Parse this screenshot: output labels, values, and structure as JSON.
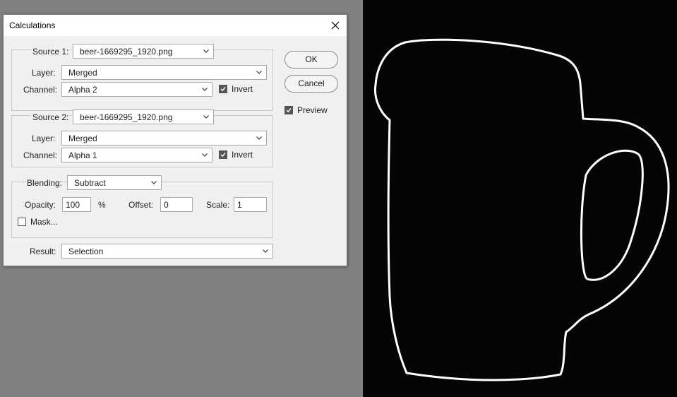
{
  "dialog": {
    "title": "Calculations",
    "source1": {
      "label": "Source 1:",
      "file": "beer-1669295_1920.png",
      "layer_label": "Layer:",
      "layer": "Merged",
      "channel_label": "Channel:",
      "channel": "Alpha 2",
      "invert_label": "Invert",
      "invert_checked": true
    },
    "source2": {
      "label": "Source 2:",
      "file": "beer-1669295_1920.png",
      "layer_label": "Layer:",
      "layer": "Merged",
      "channel_label": "Channel:",
      "channel": "Alpha 1",
      "invert_label": "Invert",
      "invert_checked": true
    },
    "blending": {
      "label": "Blending:",
      "mode": "Subtract",
      "opacity_label": "Opacity:",
      "opacity": "100",
      "percent": "%",
      "offset_label": "Offset:",
      "offset": "0",
      "scale_label": "Scale:",
      "scale": "1",
      "mask_label": "Mask...",
      "mask_checked": false
    },
    "result": {
      "label": "Result:",
      "value": "Selection"
    },
    "buttons": {
      "ok": "OK",
      "cancel": "Cancel"
    },
    "preview": {
      "label": "Preview",
      "checked": true
    }
  },
  "canvas": {
    "background": "#050505",
    "outline_color": "#ffffff",
    "content": "mug-outline"
  },
  "colors": {
    "workspace": "#808080",
    "dialog_bg": "#f0f0f0"
  }
}
